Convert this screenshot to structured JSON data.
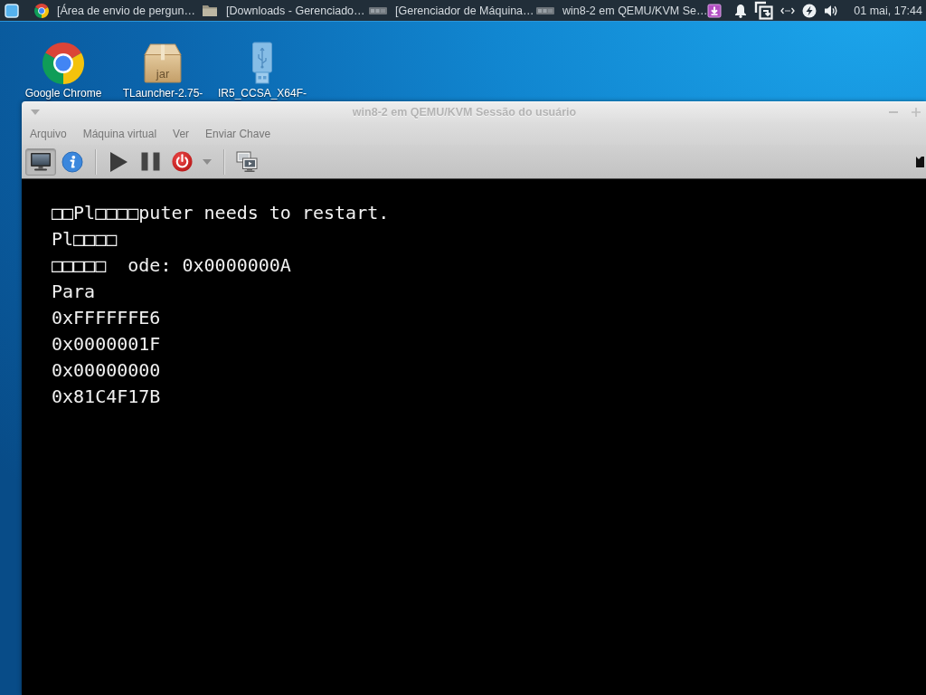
{
  "taskbar": {
    "tasks": [
      {
        "kind": "chrome",
        "label": "[Área de envio de pergun…"
      },
      {
        "kind": "folder",
        "label": "[Downloads - Gerenciado…"
      },
      {
        "kind": "vm",
        "label": "[Gerenciador de Máquina…"
      },
      {
        "kind": "vm",
        "label": "win8-2 em QEMU/KVM Se…"
      }
    ],
    "clock": "01 mai, 17:44"
  },
  "desktop": {
    "icons": [
      {
        "kind": "chrome",
        "label": "Google Chrome"
      },
      {
        "kind": "package",
        "label": "TLauncher-2.75-",
        "badge": "jar"
      },
      {
        "kind": "usb",
        "label": "IR5_CCSA_X64F-"
      }
    ]
  },
  "window": {
    "title": "win8-2 em QEMU/KVM Sessão do usuário",
    "menu": [
      "Arquivo",
      "Máquina virtual",
      "Ver",
      "Enviar Chave"
    ],
    "toolbar": [
      {
        "kind": "console",
        "selected": true
      },
      {
        "kind": "details",
        "selected": false
      },
      {
        "kind": "separator"
      },
      {
        "kind": "run"
      },
      {
        "kind": "pause"
      },
      {
        "kind": "shutdown"
      },
      {
        "kind": "shutdown_menu"
      },
      {
        "kind": "separator"
      },
      {
        "kind": "snapshots"
      },
      {
        "kind": "cut_off"
      }
    ],
    "console": {
      "lines": [
        "□□Pl□□□□puter needs to restart.",
        "Pl□□□□",
        "□□□□□  ode: 0x0000000A",
        "Para",
        "0xFFFFFFE6",
        "0x0000001F",
        "0x00000000",
        "0x81C4F17B"
      ]
    }
  }
}
